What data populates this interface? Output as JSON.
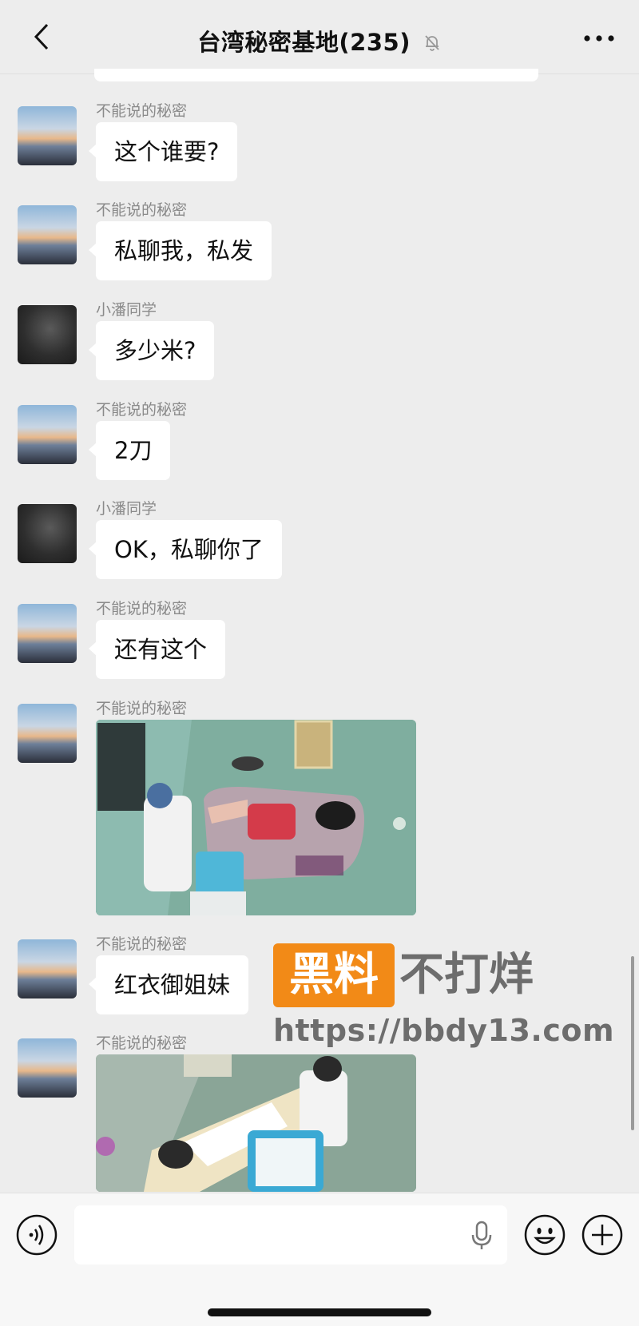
{
  "header": {
    "title": "台湾秘密基地(235)",
    "back_icon": "chevron-left-icon",
    "mute_icon": "bell-off-icon",
    "more_icon": "more-dots-icon"
  },
  "messages": [
    {
      "sender": "不能说的秘密",
      "type": "text",
      "text": "这个谁要?"
    },
    {
      "sender": "不能说的秘密",
      "type": "text",
      "text": "私聊我，私发"
    },
    {
      "sender": "小潘同学",
      "type": "text",
      "text": "多少米?"
    },
    {
      "sender": "不能说的秘密",
      "type": "text",
      "text": "2刀"
    },
    {
      "sender": "小潘同学",
      "type": "text",
      "text": "OK，私聊你了"
    },
    {
      "sender": "不能说的秘密",
      "type": "text",
      "text": "还有这个"
    },
    {
      "sender": "不能说的秘密",
      "type": "image",
      "text": ""
    },
    {
      "sender": "不能说的秘密",
      "type": "text",
      "text": "红衣御姐妹"
    },
    {
      "sender": "不能说的秘密",
      "type": "image",
      "text": ""
    }
  ],
  "watermark": {
    "box_text": "黑料",
    "text": "不打烊",
    "url": "https://bbdy13.com",
    "box_color": "#f28a17"
  },
  "input_bar": {
    "voice_icon": "voice-icon",
    "mic_icon": "mic-icon",
    "emoji_icon": "emoji-icon",
    "plus_icon": "plus-circle-icon"
  },
  "colors": {
    "background": "#ededed",
    "bubble": "#ffffff",
    "sender_text": "#8a8a8a"
  }
}
